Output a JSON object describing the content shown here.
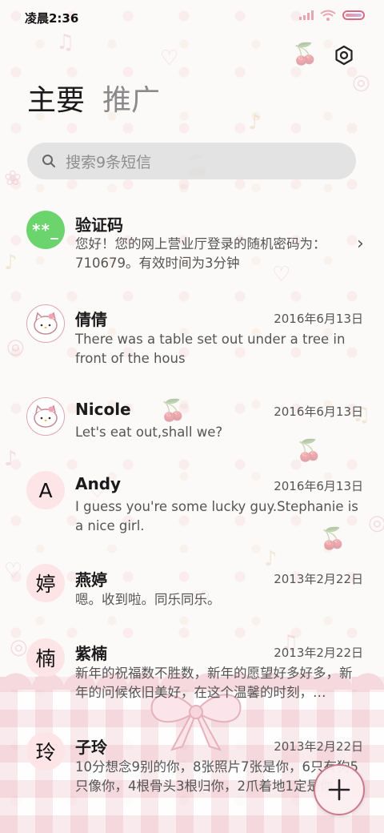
{
  "status_bar": {
    "time": "凌晨2:36"
  },
  "tabs": [
    {
      "label": "主要"
    },
    {
      "label": "推广"
    }
  ],
  "search": {
    "placeholder": "搜索9条短信"
  },
  "conversations": [
    {
      "name": "验证码",
      "avatar_text": "**_",
      "date": "",
      "snippet": "您好！您的网上营业厅登录的随机密码为：710679。有效时间为3分钟"
    },
    {
      "name": "倩倩",
      "avatar_text": "",
      "date": "2016年6月13日",
      "snippet": "There was a table set out under a tree in front of the hous"
    },
    {
      "name": "Nicole",
      "avatar_text": "",
      "date": "2016年6月13日",
      "snippet": "Let's eat out,shall we?"
    },
    {
      "name": "Andy",
      "avatar_text": "A",
      "date": "2016年6月13日",
      "snippet": "I guess you're some lucky guy.Stephanie is a nice girl."
    },
    {
      "name": "燕婷",
      "avatar_text": "婷",
      "date": "2013年2月22日",
      "snippet": "嗯。收到啦。同乐同乐。"
    },
    {
      "name": "紫楠",
      "avatar_text": "楠",
      "date": "2013年2月22日",
      "snippet": "新年的祝福数不胜数，新年的愿望好多好多，新年的问候依旧美好，在这个温馨的时刻，…"
    },
    {
      "name": "子玲",
      "avatar_text": "玲",
      "date": "2013年2月22日",
      "snippet": "10分想念9别的你，8张照片7张是你，6只有狗5只像你，4根骨头3根归你，2爪着地1定是你"
    }
  ],
  "colors": {
    "accent_pink": "#fde4e7",
    "code_avatar": "#6cd46d",
    "fab_border": "#c97b8b"
  },
  "icons": {
    "settings": "gear-icon",
    "search": "search-icon",
    "compose": "plus-icon",
    "chevron": "chevron-right-icon"
  }
}
